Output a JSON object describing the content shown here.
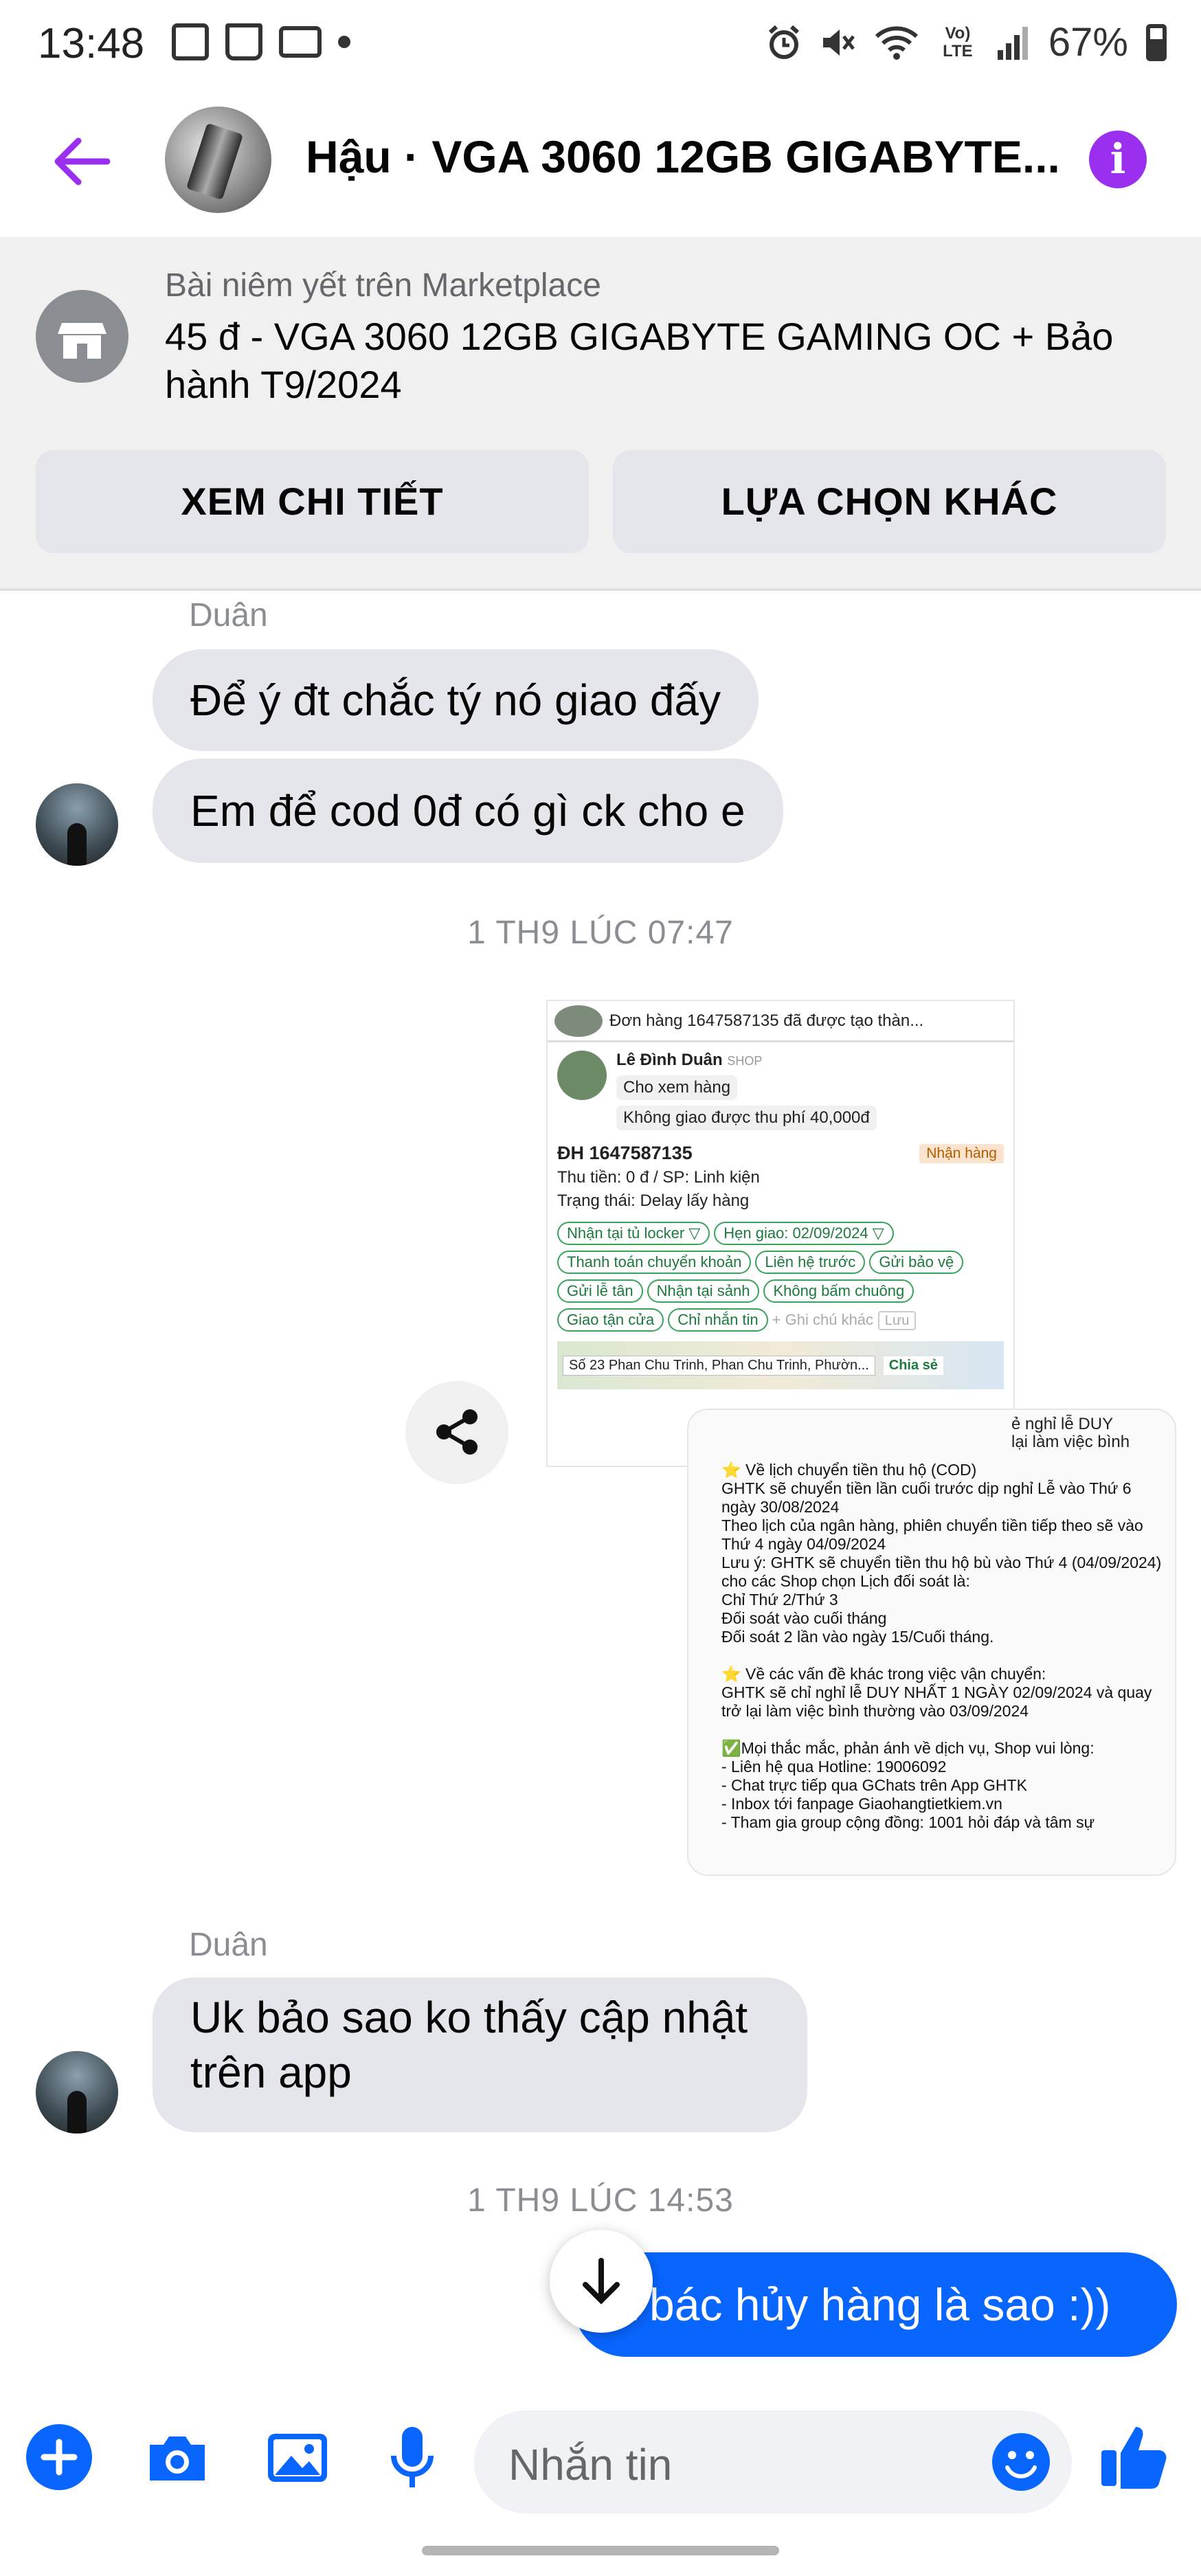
{
  "status_bar": {
    "time": "13:48",
    "battery": "67%",
    "network": "Vo) LTE"
  },
  "header": {
    "title": "Hậu · VGA 3060 12GB GIGABYTE...",
    "back_icon": "arrow-left-icon",
    "info_icon": "info-icon",
    "accent_color": "#9b2ff0"
  },
  "marketplace": {
    "subtitle": "Bài niêm yết trên Marketplace",
    "listing_title": "45 đ - VGA 3060 12GB GIGABYTE GAMING OC + Bảo hành T9/2024",
    "buttons": [
      "XEM CHI TIẾT",
      "LỰA CHỌN KHÁC"
    ]
  },
  "chat": {
    "group1": {
      "sender": "Duân",
      "messages": [
        "Để ý đt chắc tý nó giao đấy",
        "Em để cod 0đ có gì ck cho e"
      ]
    },
    "timestamp1": "1 TH9 LÚC 07:47",
    "shared_image_top": {
      "header_row": "Lê Đình Duân SHOP",
      "header_msg": "Đơn hàng 1647587135 đã được tạo thàn...",
      "shop_name": "Lê Đình Duân",
      "shop_tag": "SHOP",
      "line1": "Cho xem hàng",
      "line2": "Không giao được thu phí 40,000đ",
      "order_id": "ĐH 1647587135",
      "order_badge": "Nhận hàng",
      "money": "Thu tiền: 0 đ / SP: Linh kiện",
      "state": "Trạng thái: Delay lấy hàng",
      "chips": [
        "Nhận tại tủ locker ▽",
        "Hẹn giao: 02/09/2024 ▽",
        "Thanh toán chuyển khoản",
        "Liên hệ trước",
        "Gửi bảo vệ",
        "Gửi lễ tân",
        "Nhận tại sảnh",
        "Không bấm chuông",
        "Giao tận cửa",
        "Chỉ nhắn tin",
        "+ Ghi chú khác",
        "Lưu"
      ],
      "address": "Số 23 Phan Chu Trinh, Phan Chu Trinh, Phườn...",
      "share_label": "Chia sẻ"
    },
    "shared_image_bottom": {
      "top_text": "ẻ nghỉ lễ DUY\nlại làm việc bình",
      "body": "⭐ Về lịch chuyển tiền thu hộ (COD)\nGHTK sẽ chuyển tiền lần cuối trước dịp nghỉ Lễ vào Thứ 6 ngày 30/08/2024\nTheo lịch của ngân hàng, phiên chuyển tiền tiếp theo sẽ vào Thứ 4 ngày 04/09/2024\nLưu ý: GHTK sẽ chuyển tiền thu hộ bù vào Thứ 4 (04/09/2024) cho các Shop chọn Lịch đối soát là:\nChỉ Thứ 2/Thứ 3\nĐối soát vào cuối tháng\nĐối soát 2 lần vào ngày 15/Cuối tháng.\n\n⭐ Về các vấn đề khác trong việc vận chuyển:\nGHTK sẽ chỉ nghỉ lễ DUY NHẤT 1 NGÀY 02/09/2024 và quay trở lại làm việc bình thường vào 03/09/2024\n\n✅Mọi thắc mắc, phản ánh về dịch vụ, Shop vui lòng:\n- Liên hệ qua Hotline: 19006092\n- Chat trực tiếp qua GChats trên App GHTK\n- Inbox tới fanpage Giaohangtietkiem.vn\n- Tham gia group cộng đồng: 1001 hỏi đáp và tâm sự"
    },
    "group2": {
      "sender": "Duân",
      "messages": [
        "Uk bảo sao ko thấy cập nhật trên app"
      ]
    },
    "timestamp2": "1 TH9 LÚC 14:53",
    "outgoing": "a bác hủy hàng là sao :))"
  },
  "composer": {
    "placeholder": "Nhắn tin",
    "icons": [
      "plus-icon",
      "camera-icon",
      "image-icon",
      "microphone-icon",
      "emoji-icon",
      "thumbs-up-icon"
    ],
    "accent_color": "#0866ff"
  }
}
